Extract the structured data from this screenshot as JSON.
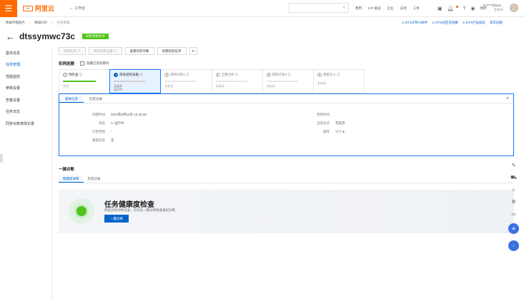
{
  "topbar": {
    "logo": "阿里云",
    "workbench": "工作台",
    "nav": [
      "费用",
      "ICP 备案",
      "企业",
      "支持",
      "工单"
    ],
    "lang": "简体",
    "user_name": "ky7***@test...",
    "user_role": "主账号"
  },
  "breadcrumb": [
    "数据传输服务",
    "数据同步",
    "任务管理"
  ],
  "right_links": [
    "DTS迁移AI助手",
    "DTS社区咨询群",
    "DTS产品动态",
    "常见问题"
  ],
  "title": "dtssymwc73c",
  "status_tag": "同步初始化中",
  "sidebar": [
    "基本信息",
    "任务管理",
    "性能监控",
    "参数设置",
    "告警设置",
    "任务日志",
    "同步对象修改记录"
  ],
  "toolbar": [
    "修改任务",
    "修改同步设置",
    "查看同步对象",
    "创建校验任务"
  ],
  "section_progress": "实例进展",
  "hide_completed": "隐藏已完成模块",
  "steps": [
    {
      "num": "✓",
      "name": "预检查",
      "sub": "完成"
    },
    {
      "num": "1",
      "name": "库表结构采集",
      "sub": "无延迟\n运行中"
    },
    {
      "num": "3",
      "name": "结构迁移1",
      "sub": "未启动"
    },
    {
      "num": "4",
      "name": "全量迁移",
      "sub": "未启动"
    },
    {
      "num": "5",
      "name": "结构迁移2",
      "sub": "未启动"
    },
    {
      "num": "6",
      "name": "增量写入",
      "sub": "未启动"
    }
  ],
  "detail": {
    "tabs": [
      "基本信息",
      "历史记录"
    ],
    "created_label": "创建时间",
    "created_value": "2024年8月10日 15:42:30",
    "status_label": "状态",
    "status_value": "运行中",
    "progress_label": "迁移范围",
    "progress_value": "-",
    "error_label": "报错信息",
    "error_value": "无",
    "update_label": "更新时间",
    "current_label": "当前位点",
    "current_value": "无延迟",
    "op_label": "操作",
    "op_value": "暂停"
  },
  "section_diag": "一键诊断",
  "diag_tabs": [
    "健康度详情",
    "历史记录"
  ],
  "health": {
    "title": "任务健康度检查",
    "desc": "目前没有诊断记录，可点击一键诊断快速发起诊断",
    "button": "一键诊断"
  }
}
